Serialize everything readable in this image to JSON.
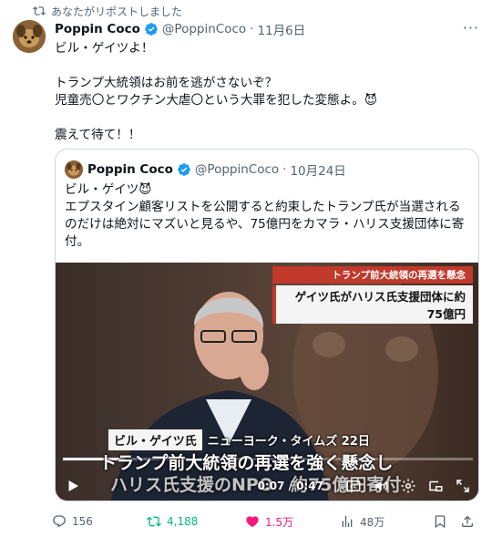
{
  "repost": {
    "label": "あなたがリポストしました",
    "icon": "repost-icon"
  },
  "tweet": {
    "author_name": "Poppin Coco",
    "handle": "@PoppinCoco",
    "date": "11月6日",
    "more": "···",
    "text": "ビル・ゲイツよ！\n\nトランプ大統領はお前を逃がさないぞ？\n児童売〇とワクチン大虐〇という大罪を犯した変態よ。😈\n\n震えて待て！！"
  },
  "quote": {
    "author_name": "Poppin Coco",
    "handle": "@PoppinCoco",
    "date": "10月24日",
    "text": "ビル・ゲイツ😈\nエプスタイン顧客リストを公開すると約束したトランプ氏が当選される\nのだけは絶対にマズいと見るや、75億円をカマラ・ハリス支援団体に寄\n付。"
  },
  "video": {
    "banner_top": "トランプ前大統領の再選を懸念",
    "banner_main": "ゲイツ氏がハリス氏支援団体に約75億円",
    "name_tag": "ビル・ゲイツ氏",
    "source": "ニューヨーク・タイムズ 22日",
    "subtitle_1": "トランプ前大統領の再選を強く懸念し",
    "subtitle_2": "ハリス氏支援のNPO　約75億円寄付",
    "time": "0:07 / 0:47",
    "progress": 0.15,
    "controls": [
      "play-icon",
      "captions-icon",
      "volume-icon",
      "settings-icon",
      "pip-icon",
      "fullscreen-icon"
    ]
  },
  "actions": {
    "replies": "156",
    "reposts": "4,188",
    "likes": "1.5万",
    "views": "48万"
  },
  "colors": {
    "repost_green": "#00ba7c",
    "like_pink": "#f91880",
    "verified_blue": "#1d9bf0",
    "muted": "#536471"
  }
}
